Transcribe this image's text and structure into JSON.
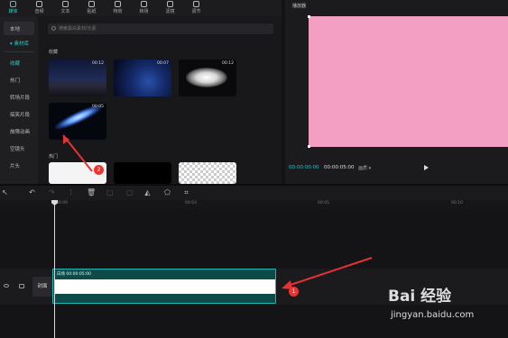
{
  "topbar": {
    "tools": [
      {
        "label": "媒体",
        "active": true
      },
      {
        "label": "音频"
      },
      {
        "label": "文本"
      },
      {
        "label": "贴纸"
      },
      {
        "label": "特效"
      },
      {
        "label": "转场"
      },
      {
        "label": "滤镜"
      },
      {
        "label": "调节"
      }
    ]
  },
  "sidebar": {
    "local": "本地",
    "library": "▾ 素材库",
    "items": [
      "收藏",
      "热门",
      "转场片段",
      "搞笑片段",
      "故障动画",
      "空镜头",
      "片头"
    ]
  },
  "content": {
    "search_placeholder": "搜索黑白素材/元素",
    "favorites_label": "收藏",
    "hot_label": "热门",
    "thumbs": [
      {
        "duration": "00:12"
      },
      {
        "duration": "00:07"
      },
      {
        "duration": "00:12"
      },
      {
        "duration": "00:05"
      }
    ],
    "badge2": "2"
  },
  "player": {
    "title": "播放器",
    "current_time": "00:00:00:00",
    "total_time": "00:00:05:00",
    "quality": "画质 ▾",
    "preview_color": "#f29fc3"
  },
  "timeline": {
    "ruler": [
      "00:00",
      "00:03",
      "00:05",
      "00:10",
      "00:20"
    ],
    "cover_label": "封面",
    "clip_label": "白场  00:00:05:00",
    "badge1": "1"
  },
  "watermark": {
    "main": "Bai 经验",
    "url": "jingyan.baidu.com"
  },
  "colors": {
    "accent": "#2ad4d4",
    "annotation": "#e33333"
  }
}
